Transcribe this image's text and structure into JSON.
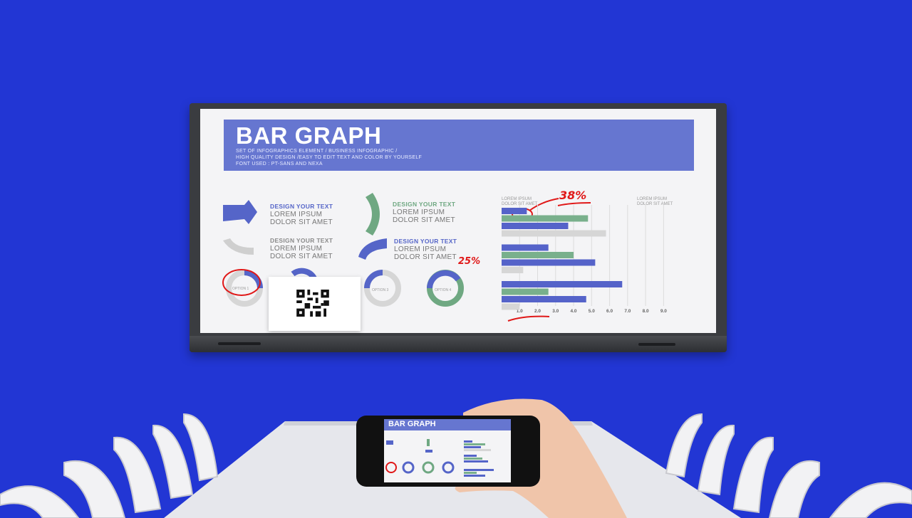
{
  "screen": {
    "title": "BAR GRAPH",
    "subtitle_lines": [
      "SET OF INFOGRAPHICS ELEMENT / BUSINESS INFOGRAPHIC /",
      "HIGH QUALITY DESIGN /EASY TO EDIT TEXT AND COLOR BY YOURSELF",
      "FONT USED : PT-SANS AND NEXA"
    ],
    "blocks": [
      {
        "heading": "DESIGN YOUR TEXT",
        "line1": "LOREM IPSUM",
        "line2": "DOLOR SIT AMET",
        "color": "#5565c8"
      },
      {
        "heading": "DESIGN YOUR TEXT",
        "line1": "LOREM IPSUM",
        "line2": "DOLOR SIT AMET",
        "color": "#6fa882"
      },
      {
        "heading": "DESIGN YOUR TEXT",
        "line1": "LOREM IPSUM",
        "line2": "DOLOR SIT AMET",
        "color": "#8a8a8a"
      },
      {
        "heading": "DESIGN YOUR TEXT",
        "line1": "LOREM IPSUM",
        "line2": "DOLOR SIT AMET",
        "color": "#5565c8"
      }
    ],
    "options": [
      "OPTION 1",
      "OPTION 3",
      "OPTION 4"
    ],
    "annotations": {
      "a38": "38%",
      "a25": "25%"
    }
  },
  "chart_data": {
    "type": "bar",
    "orientation": "horizontal",
    "labels": {
      "left": [
        "LOREM IPSUM",
        "DOLOR SIT AMET"
      ],
      "right": [
        "LOREM IPSUM",
        "DOLOR SIT AMET"
      ]
    },
    "x_ticks": [
      "1.0",
      "2.0",
      "3.0",
      "4.0",
      "5.0",
      "6.0",
      "7.0",
      "8.0",
      "9.0"
    ],
    "xlim": [
      0,
      9.5
    ],
    "groups": [
      {
        "bars": [
          {
            "color": "#5563c9",
            "value": 1.4
          },
          {
            "color": "#79b08c",
            "value": 4.8
          },
          {
            "color": "#5563c9",
            "value": 3.7
          },
          {
            "color": "#d6d6d6",
            "value": 5.8
          }
        ]
      },
      {
        "bars": [
          {
            "color": "#5563c9",
            "value": 2.6
          },
          {
            "color": "#79b08c",
            "value": 4.0
          },
          {
            "color": "#5563c9",
            "value": 5.2
          },
          {
            "color": "#d6d6d6",
            "value": 1.2
          }
        ]
      },
      {
        "bars": [
          {
            "color": "#5563c9",
            "value": 6.7
          },
          {
            "color": "#79b08c",
            "value": 2.6
          },
          {
            "color": "#5563c9",
            "value": 4.7
          },
          {
            "color": "#d6d6d6",
            "value": 1.0
          }
        ]
      }
    ]
  },
  "phone": {
    "title": "BAR GRAPH"
  },
  "colors": {
    "background": "#2236d4",
    "accent": "#6676d0",
    "annotation": "#e01818"
  }
}
